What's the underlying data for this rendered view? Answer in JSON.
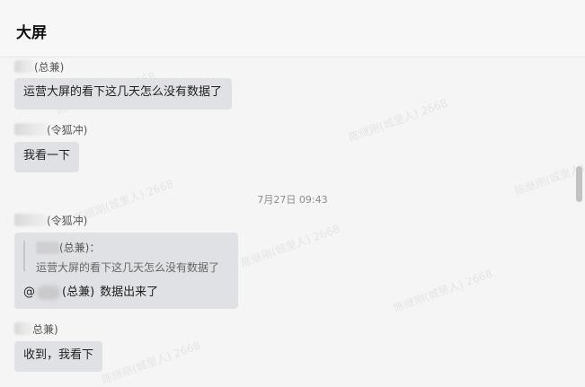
{
  "header": {
    "title": "大屏"
  },
  "watermark": "陈继刚(城里人) 2668",
  "messages": [
    {
      "sender_suffix": "(总兼)",
      "text": "运营大屏的看下这几天怎么没有数据了"
    },
    {
      "sender_suffix": "(令狐冲)",
      "text": "我看一下"
    },
    {
      "timestamp": "7月27日 09:43"
    },
    {
      "sender_suffix": "(令狐冲)",
      "quote": {
        "name_suffix": "(总兼)：",
        "text": "运营大屏的看下这几天怎么没有数据了"
      },
      "reply": {
        "at": "@",
        "mention_suffix": "(总兼)",
        "text": "数据出来了"
      }
    },
    {
      "sender_suffix": "总兼)",
      "text": "收到，我看下"
    }
  ]
}
